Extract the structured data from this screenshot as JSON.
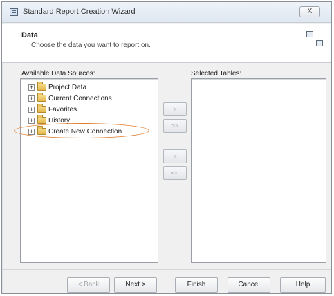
{
  "window": {
    "title": "Standard Report Creation Wizard",
    "close_label": "X"
  },
  "header": {
    "title": "Data",
    "subtitle": "Choose the data you want to report on.",
    "icon": "data-tables-icon"
  },
  "available": {
    "label": "Available Data Sources:",
    "items": [
      {
        "label": "Project Data",
        "expander": "+",
        "icon": "folder-icon"
      },
      {
        "label": "Current Connections",
        "expander": "+",
        "icon": "folder-icon"
      },
      {
        "label": "Favorites",
        "expander": "+",
        "icon": "folder-icon"
      },
      {
        "label": "History",
        "expander": "+",
        "icon": "folder-icon"
      },
      {
        "label": "Create New Connection",
        "expander": "+",
        "icon": "folder-icon",
        "highlighted": true
      }
    ]
  },
  "selected": {
    "label": "Selected Tables:"
  },
  "transfer_buttons": {
    "add": ">",
    "add_all": ">>",
    "remove": "<",
    "remove_all": "<<"
  },
  "footer": {
    "back": "< Back",
    "next": "Next >",
    "finish": "Finish",
    "cancel": "Cancel",
    "help": "Help"
  },
  "colors": {
    "highlight": "#e07d2e",
    "folder": "#e2b84b"
  }
}
